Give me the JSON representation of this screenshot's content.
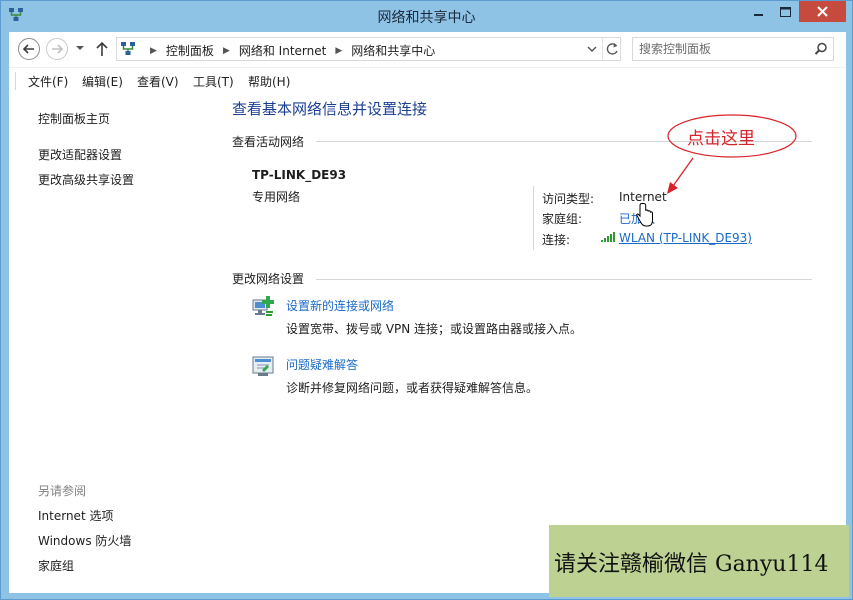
{
  "window": {
    "title": "网络和共享中心"
  },
  "address_bar": {
    "crumbs": [
      "控制面板",
      "网络和 Internet",
      "网络和共享中心"
    ]
  },
  "search": {
    "placeholder": "搜索控制面板"
  },
  "menu": {
    "items": [
      "文件(F)",
      "编辑(E)",
      "查看(V)",
      "工具(T)",
      "帮助(H)"
    ]
  },
  "left_pane": {
    "links": [
      "控制面板主页",
      "更改适配器设置",
      "更改高级共享设置"
    ],
    "see_also_heading": "另请参阅",
    "see_also": [
      "Internet 选项",
      "Windows 防火墙",
      "家庭组"
    ]
  },
  "main": {
    "title": "查看基本网络信息并设置连接",
    "active_networks_label": "查看活动网络",
    "network": {
      "name": "TP-LINK_DE93",
      "type": "专用网络",
      "access_type_label": "访问类型:",
      "access_type_value": "Internet",
      "homegroup_label": "家庭组:",
      "homegroup_value": "已加入",
      "connection_label": "连接:",
      "connection_value": "WLAN (TP-LINK_DE93)"
    },
    "change_settings_label": "更改网络设置",
    "tasks": [
      {
        "icon": "setup-connection-icon",
        "link": "设置新的连接或网络",
        "desc": "设置宽带、拨号或 VPN 连接；或设置路由器或接入点。"
      },
      {
        "icon": "troubleshoot-icon",
        "link": "问题疑难解答",
        "desc": "诊断并修复网络问题，或者获得疑难解答信息。"
      }
    ]
  },
  "annotation": {
    "text": "点击这里",
    "color": "#d8232a"
  },
  "watermark": {
    "text": "请关注赣榆微信 Ganyu114"
  },
  "colors": {
    "titlebar": "#8fc3e6",
    "close_button": "#c74a3e",
    "link": "#1a6ac7",
    "page_title": "#1c3f94"
  }
}
